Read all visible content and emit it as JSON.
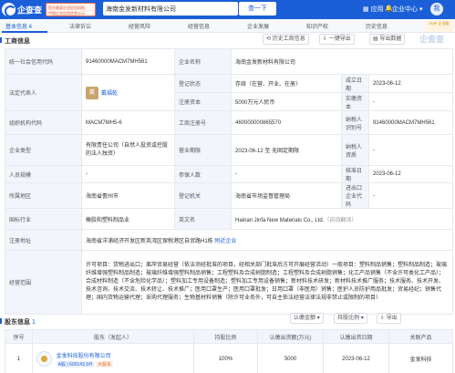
{
  "header": {
    "logo_text": "企查查",
    "logo_sub": "QCC.COM",
    "badge_line1": "官方备案企业征信机构",
    "badge_line2": "中国企业信用信息公示",
    "search_value": "海南金发新材料有限公司",
    "search_button": "查一下",
    "apps_label": "应用",
    "center_label": "企业中心",
    "user_label": "我"
  },
  "tabs": [
    {
      "label": "基本信息 4"
    },
    {
      "label": "法律诉讼"
    },
    {
      "label": "经营风险"
    },
    {
      "label": "经营信息"
    },
    {
      "label": "企业发展"
    },
    {
      "label": "知识产权"
    },
    {
      "label": "历史信息"
    }
  ],
  "vip": "SVIP 企业版",
  "section": {
    "title": "工商信息",
    "tools": [
      "历史工商信息",
      "一键导出",
      "导出数据"
    ],
    "watermark": "企查查"
  },
  "info": {
    "credit_code_label": "统一社会信用代码",
    "credit_code": "91460000MACM7MH561",
    "company_name_label": "企业名称",
    "company_name": "海南金发新材料有限公司",
    "legal_rep_label": "法定代表人",
    "legal_rep_avatar": "戴",
    "legal_rep": "戴福乾",
    "reg_status_label": "登记状态",
    "reg_status": "存续（在营、开业、在册）",
    "est_date_label": "成立日期",
    "est_date": "2023-06-12",
    "reg_capital_label": "注册资本",
    "reg_capital": "5000万元人民币",
    "paid_capital_label": "实缴资本",
    "paid_capital": "-",
    "org_code_label": "组织机构代码",
    "org_code": "MACM7MH5-6",
    "reg_no_label": "工商注册号",
    "reg_no": "460000000865570",
    "taxpayer_id_label": "纳税人识别号",
    "taxpayer_id": "91460000MACM7MH561",
    "company_type_label": "企业类型",
    "company_type": "有限责任公司（自然人投资或控股的法人独资）",
    "term_label": "营业期限",
    "term": "2023-06-12 至 无固定期限",
    "taxpayer_qual_label": "纳税人资质",
    "taxpayer_qual": "-",
    "staff_size_label": "人员规模",
    "staff_size": "-",
    "insured_label": "参保人数",
    "insured": "-",
    "approval_date_label": "核准日期",
    "approval_date": "2023-06-12",
    "region_label": "所属地区",
    "region": "海南省儋州市",
    "reg_authority_label": "登记机关",
    "reg_authority": "海南省市场监督管理局",
    "import_export_label": "进出口企业代码",
    "import_export": "-",
    "industry_label": "国标行业",
    "industry": "橡胶和塑料制品业",
    "english_name_label": "英文名",
    "english_name": "Hainan Jinfa New Materials Co., Ltd.",
    "english_name_note": "（自动翻译）",
    "address_label": "注册地址",
    "address": "海南省洋浦经济开发区新英湾区保税港区自贸路H1栋",
    "address_nearby": "附近企业",
    "scope_label": "经营范围",
    "scope": "许可项目：货物进出口；离岸贸易经营（依法须经批准的项目，经相关部门批准后方可开展经营活动）一般项目：塑料制品销售；塑料制品制造；玻璃纤维增强塑料制品制造；玻璃纤维增强塑料制品销售；工程塑料及合成树脂制造；工程塑料及合成树脂销售；化工产品销售（不含许可类化工产品）；合成材料制造（不含危险化学品）；塑料加工专用设备制造；塑料加工专用设备销售；新材料技术研发；新材料技术推广服务；技术服务、技术开发、技术咨询、技术交流、技术转让、技术推广；医用口罩生产；医用口罩批发；日用口罩（非医用）销售；医护人员防护用品批发；贸易经纪；销售代理；国内货物运输代理；采购代理服务；生物基材料销售（除许可业务外，可自主依法经营法律法规非禁止或限制的项目）"
  },
  "shareholders": {
    "title": "股东信息",
    "count": "1",
    "tools": [
      "认缴金额",
      "持股比例",
      "导出"
    ],
    "columns": [
      "序号",
      "股东（发起人）",
      "持股比例",
      "认缴出资额(万元)",
      "认缴出资日期",
      "关联产品"
    ],
    "rows": [
      {
        "index": "1",
        "name": "金发科技股份有限公司",
        "tag_stock": "A股 | 600143.SH",
        "tag_big": "大股东",
        "ratio": "100%",
        "amount": "5000",
        "date": "2023-06-12",
        "related": "金发科技"
      }
    ]
  }
}
